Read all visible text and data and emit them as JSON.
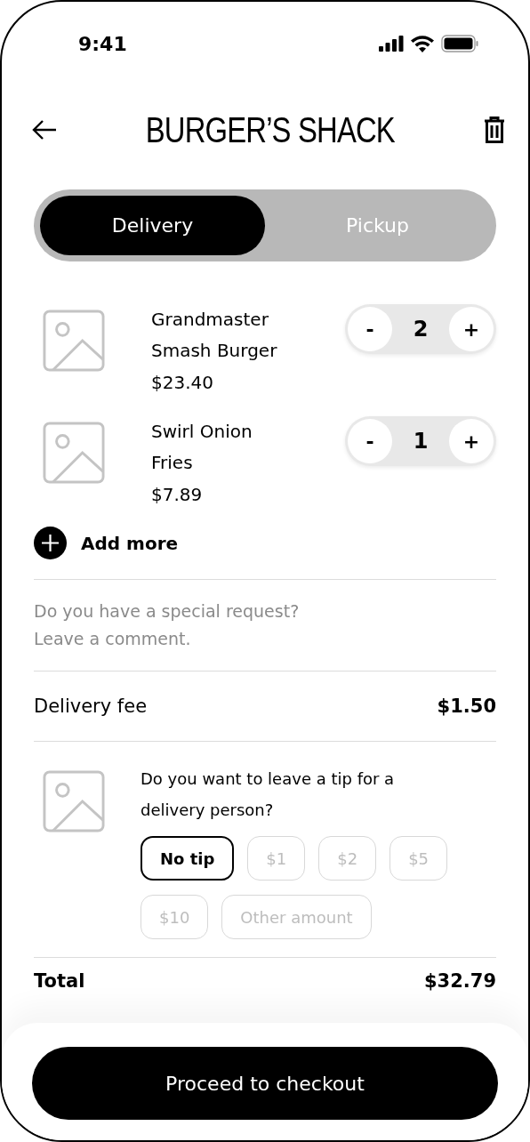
{
  "status_bar": {
    "time": "9:41"
  },
  "header": {
    "title": "BURGER’S SHACK"
  },
  "tabs": [
    {
      "label": "Delivery",
      "selected": true
    },
    {
      "label": "Pickup",
      "selected": false
    }
  ],
  "items": [
    {
      "name": "Grandmaster Smash Burger",
      "price": "$23.40",
      "minus": "-",
      "quantity": "2",
      "plus": "+"
    },
    {
      "name": "Swirl Onion Fries",
      "price": "$7.89",
      "minus": "-",
      "quantity": "1",
      "plus": "+"
    }
  ],
  "add_more": {
    "label": "Add more"
  },
  "comment": {
    "placeholder": "Do you have a special request? Leave a comment."
  },
  "delivery_fee": {
    "label": "Delivery fee",
    "value": "$1.50"
  },
  "tip": {
    "question": "Do you want to leave a tip for a delivery person?",
    "options": [
      {
        "label": "No tip",
        "selected": true
      },
      {
        "label": "$1",
        "selected": false
      },
      {
        "label": "$2",
        "selected": false
      },
      {
        "label": "$5",
        "selected": false
      },
      {
        "label": "$10",
        "selected": false
      },
      {
        "label": "Other amount",
        "selected": false
      }
    ]
  },
  "total": {
    "label": "Total",
    "value": "$32.79"
  },
  "checkout_button": {
    "label": "Proceed to checkout"
  }
}
